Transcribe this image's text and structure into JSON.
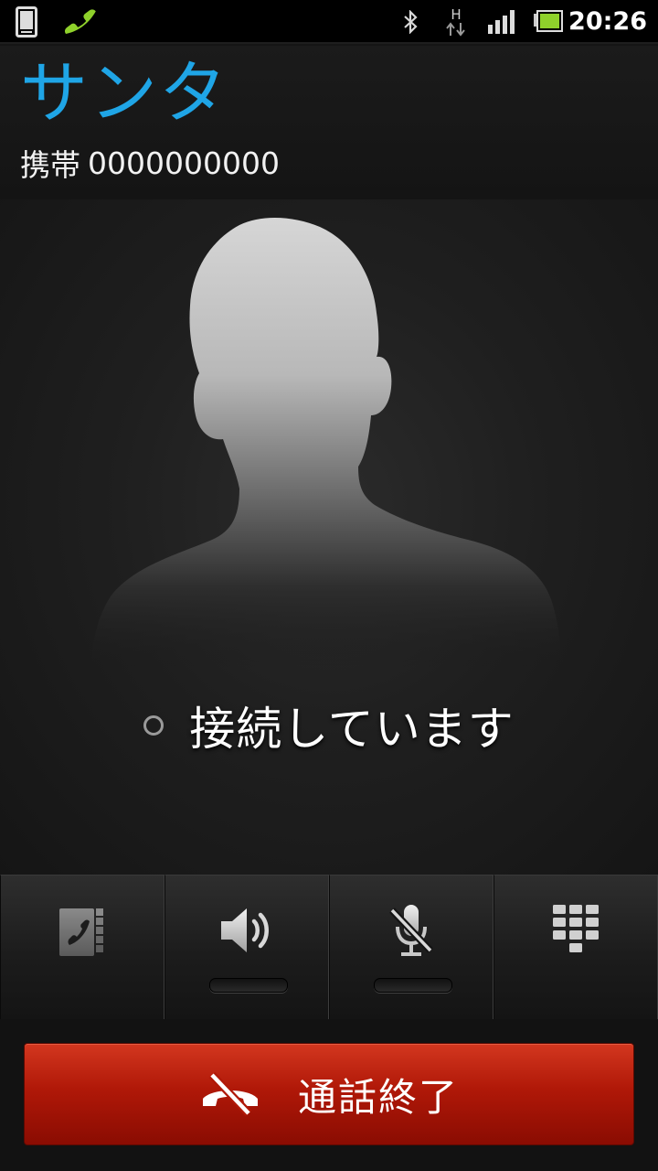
{
  "status_bar": {
    "time": "20:26",
    "network_type": "H",
    "icons": [
      "phone-device-icon",
      "call-in-progress-icon",
      "bluetooth-icon",
      "data-arrows-icon",
      "signal-icon",
      "battery-icon"
    ]
  },
  "contact": {
    "name": "サンタ",
    "number_type": "携帯",
    "number": "0000000000"
  },
  "call": {
    "status_text": "接続しています"
  },
  "controls": [
    {
      "name": "contacts",
      "icon": "contacts-book-icon"
    },
    {
      "name": "speaker",
      "icon": "speaker-icon"
    },
    {
      "name": "mute",
      "icon": "mic-muted-icon"
    },
    {
      "name": "dialpad",
      "icon": "dialpad-icon"
    }
  ],
  "end_call": {
    "label": "通話終了",
    "icon": "hang-up-icon"
  },
  "colors": {
    "accent": "#1fa5e6",
    "end_call": "#b01808",
    "call_icon": "#8fd12b"
  }
}
